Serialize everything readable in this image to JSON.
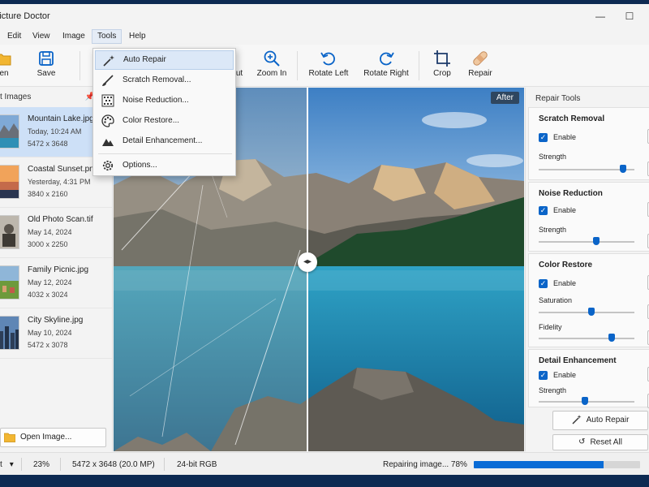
{
  "window": {
    "title": "Picture Doctor",
    "minimize": "—",
    "maximize": "☐"
  },
  "menu": {
    "items": [
      "Edit",
      "View",
      "Image",
      "Tools",
      "Help"
    ],
    "file_partial": ""
  },
  "toolbar": {
    "open": "en",
    "save": "Save",
    "zoom_out": "ut",
    "zoom_in": "Zoom In",
    "rotate_left": "Rotate Left",
    "rotate_right": "Rotate Right",
    "crop": "Crop",
    "repair": "Repair"
  },
  "tools_menu": {
    "items": [
      "Auto Repair",
      "Scratch Removal...",
      "Noise Reduction...",
      "Color Restore...",
      "Detail Enhancement..."
    ],
    "options": "Options..."
  },
  "left_panel": {
    "header": "t Images",
    "pin": "📌",
    "files": [
      {
        "name": "Mountain Lake.jpg",
        "date": "Today, 10:24 AM",
        "size": "5472 x 3648"
      },
      {
        "name": "Coastal Sunset.png",
        "date": "Yesterday, 4:31 PM",
        "size": "3840 x 2160"
      },
      {
        "name": "Old Photo Scan.tif",
        "date": "May 14, 2024",
        "size": "3000 x 2250"
      },
      {
        "name": "Family Picnic.jpg",
        "date": "May 12, 2024",
        "size": "4032 x 3024"
      },
      {
        "name": "City Skyline.jpg",
        "date": "May 10, 2024",
        "size": "5472 x 3078"
      }
    ],
    "open_button": "Open Image..."
  },
  "viewer": {
    "after_label": "After",
    "split_position": 0.47
  },
  "repair_tools": {
    "title": "Repair Tools",
    "scratch": {
      "title": "Scratch Removal",
      "enable": "Enable",
      "strength_label": "Strength",
      "strength": 0.88
    },
    "noise": {
      "title": "Noise Reduction",
      "enable": "Enable",
      "strength_label": "Strength",
      "strength": 0.6
    },
    "color": {
      "title": "Color Restore",
      "enable": "Enable",
      "saturation_label": "Saturation",
      "saturation": 0.55,
      "fidelity_label": "Fidelity",
      "fidelity": 0.76
    },
    "detail": {
      "title": "Detail Enhancement",
      "enable": "Enable",
      "strength_label": "Strength",
      "strength": 0.48
    },
    "auto_repair": "Auto Repair",
    "reset_all": "Reset All"
  },
  "status": {
    "dropdown": "t",
    "zoom": "23%",
    "dimensions": "5472 x 3648 (20.0 MP)",
    "depth": "24-bit RGB",
    "progress_text": "Repairing image... 78%",
    "progress": 0.78
  },
  "colors": {
    "accent": "#0a64c8",
    "selection": "#cde0f7",
    "progress": "#0a6cd6"
  }
}
